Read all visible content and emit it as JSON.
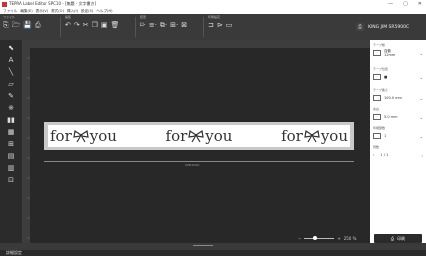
{
  "window": {
    "title": "TEPRA Label Editor SPC10 - [無題 - 文字書き]",
    "controls": [
      "—",
      "▢",
      "✕"
    ]
  },
  "menu": [
    "ファイル",
    "編集(E)",
    "表示(V)",
    "書式(O)",
    "挿入(I)",
    "設定(S)",
    "ヘルプ(H)"
  ],
  "toolbar": {
    "groups": [
      {
        "label": "ファイル",
        "icons": [
          "new-doc-icon",
          "open-icon",
          "save-icon",
          "print-preview-icon"
        ]
      },
      {
        "label": "編集",
        "icons": [
          "undo-icon",
          "redo-icon",
          "cut-icon",
          "copy-icon",
          "paste-icon",
          "delete-icon"
        ]
      },
      {
        "label": "配置",
        "icons": [
          "frame-icon",
          "align-icon",
          "layer-icon",
          "group-icon",
          "arrange-icon"
        ]
      },
      {
        "label": "印刷設定",
        "icons": [
          "printer-settings-icon",
          "continuous-icon",
          "tape-icon"
        ]
      }
    ],
    "printer_name": "KING JIM SR5900C"
  },
  "lefttools": [
    "select-tool-icon",
    "text-tool-icon",
    "line-tool-icon",
    "shape-tool-icon",
    "image-tool-icon",
    "symbol-tool-icon",
    "barcode-tool-icon",
    "qrcode-tool-icon",
    "table-tool-icon",
    "frame-tool-icon",
    "date-tool-icon",
    "clip-tool-icon"
  ],
  "canvas": {
    "label_words": [
      "for",
      "you",
      "for",
      "you",
      "for",
      "you"
    ],
    "dimension": "128.0mm",
    "zoom": "250 %"
  },
  "rightpanel": {
    "sections": [
      {
        "label": "テープ幅",
        "value": "自動\n12mm"
      },
      {
        "label": "テープ位置",
        "value": "■"
      },
      {
        "label": "テープ長さ",
        "value": "100.0 mm"
      },
      {
        "label": "余白",
        "value": "5.0 mm"
      },
      {
        "label": "印刷部数",
        "value": "1"
      },
      {
        "label": "頁数",
        "value": "1 / 1"
      }
    ],
    "print_button": "印刷"
  },
  "status": "詳細設定",
  "colors": {
    "toolbar": "#3a3a3a",
    "canvas": "#282828",
    "label_bg": "#ffffff",
    "accent": "#c33333"
  }
}
